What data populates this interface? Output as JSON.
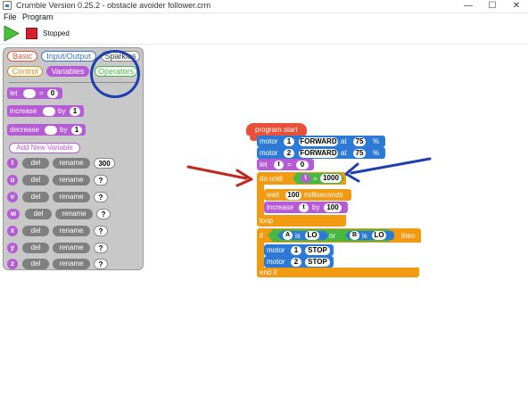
{
  "window": {
    "title": "Crumble Version 0.25.2 - obstacle avoider follower.crm",
    "minimize": "—",
    "maximize": "☐",
    "close": "✕"
  },
  "menu": {
    "file": "File",
    "program": "Program"
  },
  "toolbar": {
    "status": "Stopped"
  },
  "palette": {
    "categories": {
      "basic": "Basic",
      "io": "Input/Output",
      "sparkles": "Sparkles",
      "control": "Control",
      "variables": "Variables",
      "operators": "Operators"
    },
    "blocks": {
      "let_label": "let",
      "let_eq": "=",
      "let_value": "0",
      "increase_label": "increase",
      "increase_by": "by",
      "increase_value": "1",
      "decrease_label": "decrease",
      "decrease_by": "by",
      "decrease_value": "1"
    },
    "add_variable": "Add New Variable",
    "variables": [
      {
        "name": "t",
        "del": "del",
        "rename": "rename",
        "value": "300"
      },
      {
        "name": "u",
        "del": "del",
        "rename": "rename",
        "value": "?"
      },
      {
        "name": "v",
        "del": "del",
        "rename": "rename",
        "value": "?"
      },
      {
        "name": "w",
        "del": "del",
        "rename": "rename",
        "value": "?"
      },
      {
        "name": "x",
        "del": "del",
        "rename": "rename",
        "value": "?"
      },
      {
        "name": "y",
        "del": "del",
        "rename": "rename",
        "value": "?"
      },
      {
        "name": "z",
        "del": "del",
        "rename": "rename",
        "value": "?"
      }
    ]
  },
  "program": {
    "start": "program start",
    "motor1": {
      "label": "motor",
      "num": "1",
      "dir": "FORWARD",
      "at": "at",
      "speed": "75",
      "pct": "%"
    },
    "motor2": {
      "label": "motor",
      "num": "2",
      "dir": "FORWARD",
      "at": "at",
      "speed": "75",
      "pct": "%"
    },
    "let": {
      "label": "let",
      "var": "t",
      "eq": "=",
      "value": "0"
    },
    "do_until": {
      "label": "do until",
      "var": "t",
      "eq": "=",
      "value": "1000"
    },
    "wait": {
      "label": "wait",
      "value": "100",
      "unit": "milliseconds"
    },
    "increase": {
      "label": "increase",
      "var": "t",
      "by": "by",
      "value": "100"
    },
    "loop": "loop",
    "if": {
      "label": "if",
      "a": "A",
      "is1": "is",
      "lo1": "LO",
      "or": "or",
      "b": "B",
      "is2": "is",
      "lo2": "LO",
      "then": "then"
    },
    "stop1": {
      "label": "motor",
      "num": "1",
      "action": "STOP"
    },
    "stop2": {
      "label": "motor",
      "num": "2",
      "action": "STOP"
    },
    "end_if": "end if"
  },
  "colors": {
    "variables": "#b55bd6",
    "motor": "#2d7ad6",
    "control": "#f29a12",
    "operators": "#49b843",
    "start": "#e8503a",
    "stop_button": "#d42030",
    "annotation_red": "#c0281e",
    "annotation_blue": "#1f3fb0"
  },
  "icons": {
    "play": "play-icon",
    "stop": "stop-icon",
    "app": "crumble-app-icon"
  }
}
